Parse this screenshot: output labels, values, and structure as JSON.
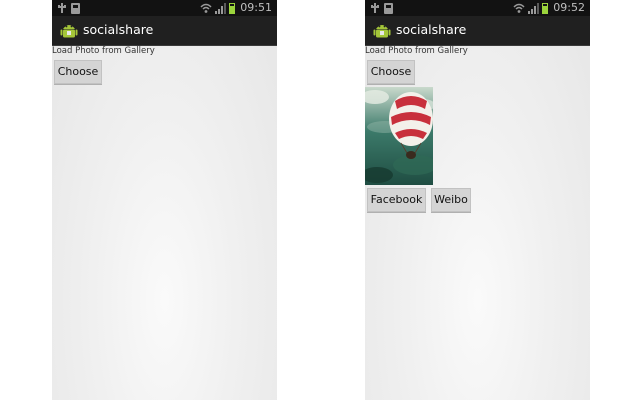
{
  "screens": [
    {
      "status": {
        "time": "09:51"
      },
      "app_title": "socialshare",
      "load_label": "Load Photo from Gallery",
      "choose_label": "Choose"
    },
    {
      "status": {
        "time": "09:52"
      },
      "app_title": "socialshare",
      "load_label": "Load Photo from Gallery",
      "choose_label": "Choose",
      "share_buttons": [
        "Facebook",
        "Weibo"
      ]
    }
  ],
  "colors": {
    "status_bar": "#121212",
    "action_bar": "#202020",
    "battery": "#9bd43c",
    "button": "#d4d4d4"
  },
  "icons": [
    "usb-icon",
    "sd-card-icon",
    "wifi-icon",
    "signal-icon",
    "battery-icon",
    "android-app-icon"
  ]
}
